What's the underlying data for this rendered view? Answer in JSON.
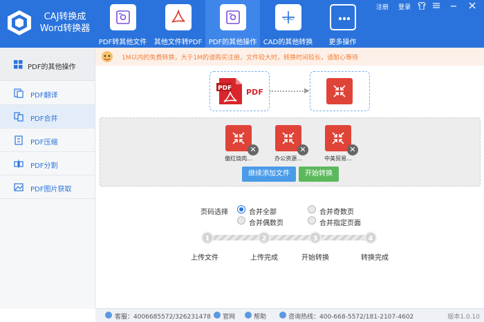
{
  "app": {
    "title_line1": "CAJ转换成",
    "title_line2": "Word转换器"
  },
  "toolbar": {
    "tabs": [
      {
        "label": "PDF转其他文件",
        "icon": "gear-doc-icon"
      },
      {
        "label": "其他文件转PDF",
        "icon": "acrobat-icon"
      },
      {
        "label": "PDF的其他操作",
        "icon": "gear-doc-icon",
        "active": true
      },
      {
        "label": "CAD的其他转换",
        "icon": "cad-icon"
      },
      {
        "label": "更多操作",
        "icon": "more-dots-icon"
      }
    ],
    "register": "注册",
    "login": "登录"
  },
  "sidebar": {
    "header": "PDF的其他操作",
    "items": [
      {
        "label": "PDF翻译",
        "icon": "translate-icon"
      },
      {
        "label": "PDF合并",
        "icon": "merge-icon",
        "active": true
      },
      {
        "label": "PDF压缩",
        "icon": "compress-icon"
      },
      {
        "label": "PDF分割",
        "icon": "split-icon"
      },
      {
        "label": "PDF图片获取",
        "icon": "image-icon"
      }
    ]
  },
  "notice": {
    "text": "1M以内的免费转换，大于1M的请购买注册，文件较大时，转换时间较长，请耐心等待"
  },
  "flow": {
    "source_label": "PDF"
  },
  "files": [
    {
      "name": "傲红烧肉..."
    },
    {
      "name": "办公资源..."
    },
    {
      "name": "中美贸易..."
    }
  ],
  "actions": {
    "add_more": "继续添加文件",
    "start": "开始转换"
  },
  "options": {
    "title": "页码选择",
    "choices": [
      {
        "label": "合并全部",
        "checked": true
      },
      {
        "label": "合并奇数页",
        "checked": false
      },
      {
        "label": "合并偶数页",
        "checked": false
      },
      {
        "label": "合并指定页面",
        "checked": false
      }
    ]
  },
  "steps": [
    {
      "num": "1",
      "label": "上传文件"
    },
    {
      "num": "2",
      "label": "上传完成"
    },
    {
      "num": "3",
      "label": "开始转换"
    },
    {
      "num": "4",
      "label": "转换完成"
    }
  ],
  "footer": {
    "qq": "客服：4006685572/326231478",
    "website": "官网",
    "help": "帮助",
    "hotline": "咨询热线：400-668-5572/181-2107-4602",
    "version": "版本1.0.10"
  },
  "colors": {
    "primary": "#2a73dc",
    "accent_red": "#e04337",
    "green": "#5cb85c",
    "blue_btn": "#4a9be8",
    "notice": "#f0803b"
  }
}
